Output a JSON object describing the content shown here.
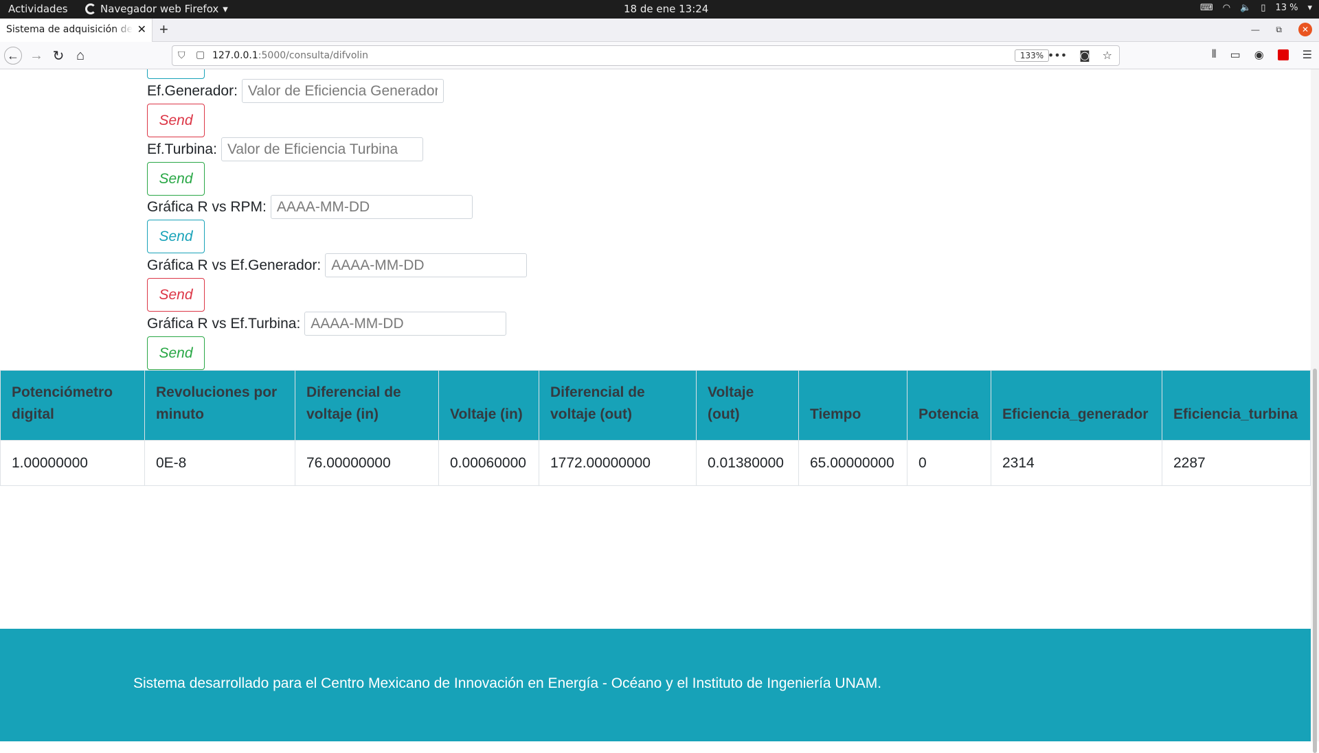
{
  "system": {
    "activities": "Actividades",
    "app_name": "Navegador web Firefox",
    "clock": "18 de ene  13:24",
    "battery": "13 %"
  },
  "browser": {
    "tab_title": "Sistema de adquisición de datos",
    "url_host": "127.0.0.1",
    "url_path": ":5000/consulta/difvolin",
    "zoom": "133%"
  },
  "form": {
    "fields": [
      {
        "label": "Ef.Generador:",
        "placeholder": "Valor de Eficiencia Generador",
        "button": "Send"
      },
      {
        "label": "Ef.Turbina:",
        "placeholder": "Valor de Eficiencia Turbina",
        "button": "Send"
      },
      {
        "label": "Gráfica R vs RPM:",
        "placeholder": "AAAA-MM-DD",
        "button": "Send"
      },
      {
        "label": "Gráfica R vs Ef.Generador:",
        "placeholder": "AAAA-MM-DD",
        "button": "Send"
      },
      {
        "label": "Gráfica R vs Ef.Turbina:",
        "placeholder": "AAAA-MM-DD",
        "button": "Send"
      }
    ]
  },
  "table": {
    "headers": [
      "Potenciómetro digital",
      "Revoluciones por minuto",
      "Diferencial de voltaje (in)",
      "Voltaje (in)",
      "Diferencial de voltaje (out)",
      "Voltaje (out)",
      "Tiempo",
      "Potencia",
      "Eficiencia_generador",
      "Eficiencia_turbina"
    ],
    "rows": [
      [
        "1.00000000",
        "0E-8",
        "76.00000000",
        "0.00060000",
        "1772.00000000",
        "0.01380000",
        "65.00000000",
        "0",
        "2314",
        "2287"
      ]
    ]
  },
  "footer": {
    "text": "Sistema desarrollado para el Centro Mexicano de Innovación en Energía - Océano y el Instituto de Ingeniería UNAM."
  },
  "colors": {
    "accent": "#17a2b8",
    "danger": "#dc3545",
    "success": "#28a745"
  }
}
